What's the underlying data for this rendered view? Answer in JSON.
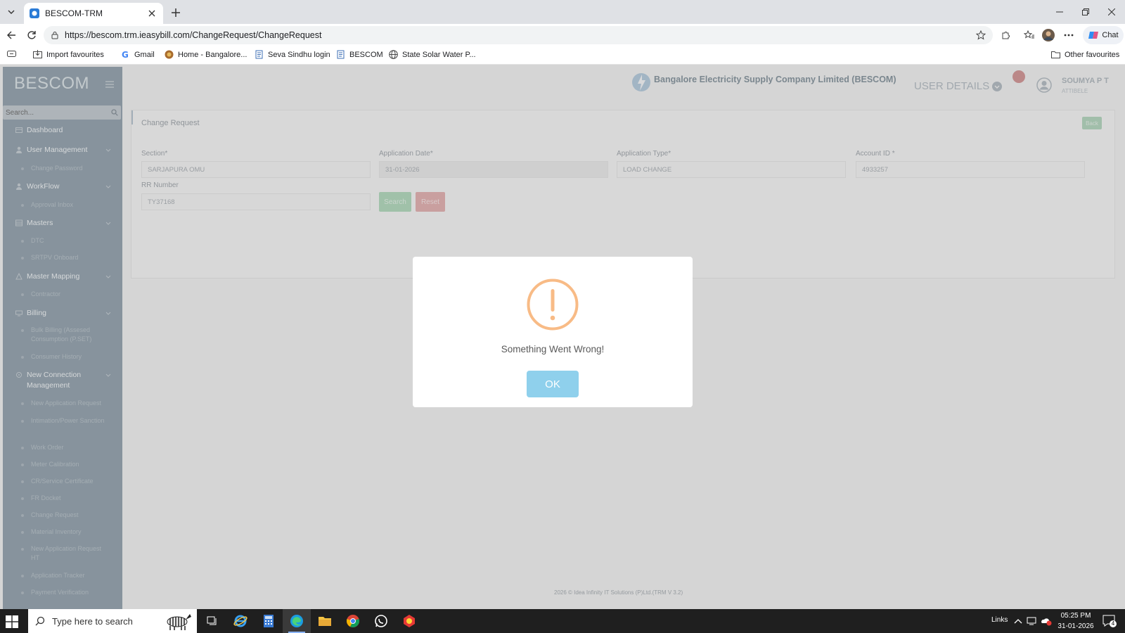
{
  "browser": {
    "tab_title": "BESCOM-TRM",
    "url": "https://bescom.trm.ieasybill.com/ChangeRequest/ChangeRequest",
    "chat_label": "Chat",
    "bookmarks": [
      "Import favourites",
      "Gmail",
      "Home - Bangalore...",
      "Seva Sindhu login",
      "BESCOM",
      "State Solar Water P..."
    ],
    "other_favourites": "Other favourites"
  },
  "sidebar": {
    "logo": "BESCOM",
    "search_placeholder": "Search...",
    "items": [
      {
        "label": "Dashboard",
        "icon": "dashboard-icon"
      },
      {
        "label": "User Management",
        "icon": "user-icon",
        "sub": [
          "Change Password"
        ]
      },
      {
        "label": "WorkFlow",
        "icon": "workflow-icon",
        "sub": [
          "Approval Inbox"
        ]
      },
      {
        "label": "Masters",
        "icon": "masters-icon",
        "sub": [
          "DTC",
          "SRTPV Onboard"
        ]
      },
      {
        "label": "Master Mapping",
        "icon": "mapping-icon",
        "sub": [
          "Contractor"
        ]
      },
      {
        "label": "Billing",
        "icon": "billing-icon",
        "sub": [
          "Bulk Billing (Assesed Consumption (P.SET)",
          "Consumer History"
        ]
      },
      {
        "label": "New Connection Management",
        "icon": "connection-icon",
        "sub": [
          "New Application Request",
          "Intimation/Power Sanction",
          "Work Order",
          "Meter Calibration",
          "CR/Service Certificate",
          "FR Docket",
          "Change Request",
          "Material Inventory",
          "New Application Request HT",
          "Application Tracker",
          "Payment Verification"
        ]
      }
    ]
  },
  "header": {
    "company": "Bangalore Electricity Supply Company Limited (BESCOM)",
    "user_details": "USER DETAILS",
    "user_name": "SOUMYA P T",
    "user_location": "ATTIBELE"
  },
  "form": {
    "title": "Change Request",
    "back_label": "Back",
    "section_label": "Section*",
    "section_value": "SARJAPURA OMU",
    "app_date_label": "Application Date*",
    "app_date_value": "31-01-2026",
    "app_type_label": "Application Type*",
    "app_type_value": "LOAD CHANGE",
    "account_label": "Account ID *",
    "account_value": "4933257",
    "rr_label": "RR Number",
    "rr_value": "TY37168",
    "search_label": "Search",
    "reset_label": "Reset"
  },
  "footer": "2026 © Idea Infinity IT Solutions (P)Ltd.(TRM V 3.2)",
  "modal": {
    "message": "Something Went Wrong!",
    "ok_label": "OK",
    "icon_color": "#f8bb86",
    "ok_color": "#8fd0ec"
  },
  "taskbar": {
    "search_placeholder": "Type here to search",
    "links_label": "Links",
    "time": "05:25 PM",
    "date": "31-01-2026",
    "notification_count": "4"
  }
}
